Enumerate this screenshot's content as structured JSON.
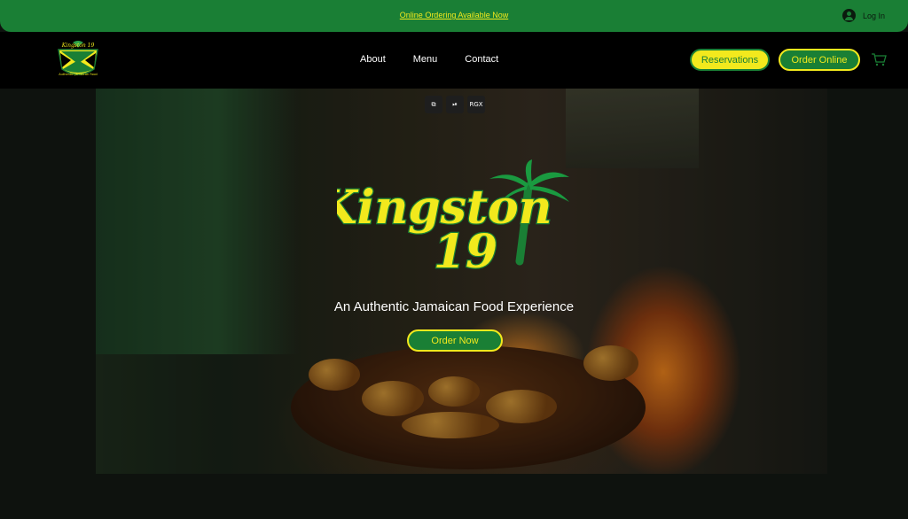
{
  "banner": {
    "promo_text": "Online Ordering Available Now",
    "login_label": "Log In"
  },
  "header": {
    "logo_text": "Kingston 19",
    "nav": [
      {
        "label": "About"
      },
      {
        "label": "Menu"
      },
      {
        "label": "Contact"
      }
    ],
    "reservations_label": "Reservations",
    "order_online_label": "Order Online",
    "cart_icon": "cart-icon"
  },
  "hero": {
    "media_controls": [
      {
        "icon": "fullscreen-icon",
        "label": ""
      },
      {
        "icon": "play-pause-icon",
        "label": ""
      },
      {
        "icon": "rgx-icon",
        "label": "RGX"
      }
    ],
    "brand_line1": "Kingston",
    "brand_line2": "19",
    "tagline": "An Authentic Jamaican Food  Experience",
    "cta_label": "Order Now"
  },
  "colors": {
    "green": "#1a7f35",
    "yellow": "#f2e91d",
    "black": "#000000",
    "white": "#ffffff"
  }
}
